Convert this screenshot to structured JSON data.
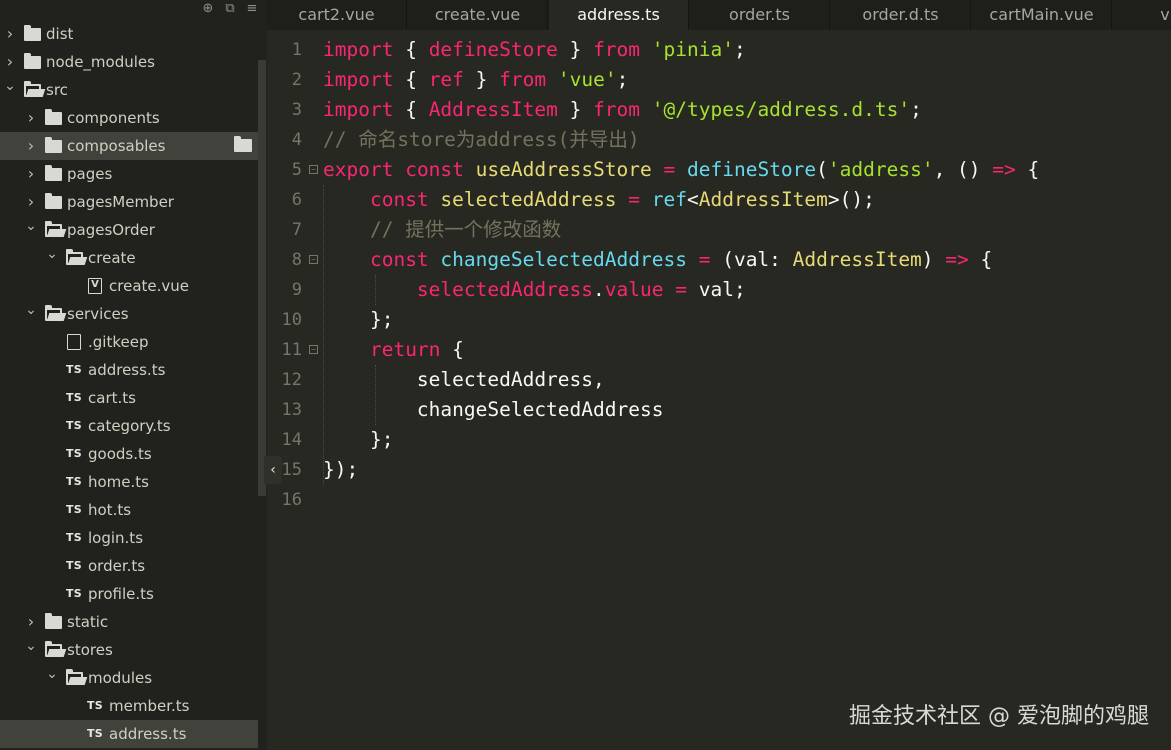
{
  "sidebar": {
    "toolbar": {
      "icons": [
        "locate-icon",
        "collapse-all-icon",
        "menu-icon"
      ]
    },
    "tree": [
      {
        "label": "dist",
        "type": "folder",
        "expanded": false,
        "depth": 0
      },
      {
        "label": "node_modules",
        "type": "folder",
        "expanded": false,
        "depth": 0
      },
      {
        "label": "src",
        "type": "folder",
        "expanded": true,
        "depth": 0
      },
      {
        "label": "components",
        "type": "folder",
        "expanded": false,
        "depth": 1
      },
      {
        "label": "composables",
        "type": "folder",
        "expanded": false,
        "depth": 1,
        "hovered": true
      },
      {
        "label": "pages",
        "type": "folder",
        "expanded": false,
        "depth": 1
      },
      {
        "label": "pagesMember",
        "type": "folder",
        "expanded": false,
        "depth": 1
      },
      {
        "label": "pagesOrder",
        "type": "folder",
        "expanded": true,
        "depth": 1
      },
      {
        "label": "create",
        "type": "folder",
        "expanded": true,
        "depth": 2
      },
      {
        "label": "create.vue",
        "type": "vue",
        "depth": 3
      },
      {
        "label": "services",
        "type": "folder",
        "expanded": true,
        "depth": 1
      },
      {
        "label": ".gitkeep",
        "type": "file",
        "depth": 2
      },
      {
        "label": "address.ts",
        "type": "ts",
        "depth": 2
      },
      {
        "label": "cart.ts",
        "type": "ts",
        "depth": 2
      },
      {
        "label": "category.ts",
        "type": "ts",
        "depth": 2
      },
      {
        "label": "goods.ts",
        "type": "ts",
        "depth": 2
      },
      {
        "label": "home.ts",
        "type": "ts",
        "depth": 2
      },
      {
        "label": "hot.ts",
        "type": "ts",
        "depth": 2
      },
      {
        "label": "login.ts",
        "type": "ts",
        "depth": 2
      },
      {
        "label": "order.ts",
        "type": "ts",
        "depth": 2
      },
      {
        "label": "profile.ts",
        "type": "ts",
        "depth": 2
      },
      {
        "label": "static",
        "type": "folder",
        "expanded": false,
        "depth": 1
      },
      {
        "label": "stores",
        "type": "folder",
        "expanded": true,
        "depth": 1
      },
      {
        "label": "modules",
        "type": "folder",
        "expanded": true,
        "depth": 2
      },
      {
        "label": "member.ts",
        "type": "ts",
        "depth": 3
      },
      {
        "label": "address.ts",
        "type": "ts",
        "depth": 3,
        "selected": true
      }
    ],
    "ts_badge": "TS",
    "vue_badge": "V"
  },
  "tabs": [
    {
      "label": "cart2.vue",
      "active": false
    },
    {
      "label": "create.vue",
      "active": false
    },
    {
      "label": "address.ts",
      "active": true
    },
    {
      "label": "order.ts",
      "active": false
    },
    {
      "label": "order.d.ts",
      "active": false
    },
    {
      "label": "cartMain.vue",
      "active": false
    },
    {
      "label": "vk-da",
      "active": false
    }
  ],
  "editor": {
    "lines": [
      {
        "n": "1",
        "fold": false,
        "tokens": [
          [
            "k",
            "import"
          ],
          [
            "o",
            " { "
          ],
          [
            "v",
            "defineStore"
          ],
          [
            "o",
            " } "
          ],
          [
            "k",
            "from"
          ],
          [
            "o",
            " "
          ],
          [
            "s",
            "'pinia'"
          ],
          [
            "o",
            ";"
          ]
        ]
      },
      {
        "n": "2",
        "fold": false,
        "tokens": [
          [
            "k",
            "import"
          ],
          [
            "o",
            " { "
          ],
          [
            "v",
            "ref"
          ],
          [
            "o",
            " } "
          ],
          [
            "k",
            "from"
          ],
          [
            "o",
            " "
          ],
          [
            "s",
            "'vue'"
          ],
          [
            "o",
            ";"
          ]
        ]
      },
      {
        "n": "3",
        "fold": false,
        "tokens": [
          [
            "k",
            "import"
          ],
          [
            "o",
            " { "
          ],
          [
            "v",
            "AddressItem"
          ],
          [
            "o",
            " } "
          ],
          [
            "k",
            "from"
          ],
          [
            "o",
            " "
          ],
          [
            "s",
            "'@/types/address.d.ts'"
          ],
          [
            "o",
            ";"
          ]
        ]
      },
      {
        "n": "4",
        "fold": false,
        "tokens": [
          [
            "c",
            "// 命名store为address(并导出)"
          ]
        ]
      },
      {
        "n": "5",
        "fold": true,
        "tokens": [
          [
            "k",
            "export"
          ],
          [
            "o",
            " "
          ],
          [
            "k",
            "const"
          ],
          [
            "o",
            " "
          ],
          [
            "t",
            "useAddressStore"
          ],
          [
            "o",
            " "
          ],
          [
            "p",
            "="
          ],
          [
            "o",
            " "
          ],
          [
            "f",
            "defineStore"
          ],
          [
            "o",
            "("
          ],
          [
            "s",
            "'address'"
          ],
          [
            "o",
            ", () "
          ],
          [
            "p",
            "=>"
          ],
          [
            "o",
            " {"
          ]
        ]
      },
      {
        "n": "6",
        "fold": false,
        "tokens": [
          [
            "o",
            "    "
          ],
          [
            "k",
            "const"
          ],
          [
            "o",
            " "
          ],
          [
            "t",
            "selectedAddress"
          ],
          [
            "o",
            " "
          ],
          [
            "p",
            "="
          ],
          [
            "o",
            " "
          ],
          [
            "f",
            "ref"
          ],
          [
            "o",
            "<"
          ],
          [
            "t",
            "AddressItem"
          ],
          [
            "o",
            ">();"
          ]
        ]
      },
      {
        "n": "7",
        "fold": false,
        "tokens": [
          [
            "o",
            "    "
          ],
          [
            "c",
            "// 提供一个修改函数"
          ]
        ]
      },
      {
        "n": "8",
        "fold": true,
        "tokens": [
          [
            "o",
            "    "
          ],
          [
            "k",
            "const"
          ],
          [
            "o",
            " "
          ],
          [
            "f",
            "changeSelectedAddress"
          ],
          [
            "o",
            " "
          ],
          [
            "p",
            "="
          ],
          [
            "o",
            " (val: "
          ],
          [
            "t",
            "AddressItem"
          ],
          [
            "o",
            ") "
          ],
          [
            "p",
            "=>"
          ],
          [
            "o",
            " {"
          ]
        ]
      },
      {
        "n": "9",
        "fold": false,
        "tokens": [
          [
            "o",
            "        "
          ],
          [
            "v",
            "selectedAddress"
          ],
          [
            "o",
            "."
          ],
          [
            "v",
            "value"
          ],
          [
            "o",
            " "
          ],
          [
            "p",
            "="
          ],
          [
            "o",
            " val;"
          ]
        ]
      },
      {
        "n": "10",
        "fold": false,
        "tokens": [
          [
            "o",
            "    };"
          ]
        ]
      },
      {
        "n": "11",
        "fold": true,
        "tokens": [
          [
            "o",
            "    "
          ],
          [
            "k",
            "return"
          ],
          [
            "o",
            " {"
          ]
        ]
      },
      {
        "n": "12",
        "fold": false,
        "tokens": [
          [
            "o",
            "        selectedAddress,"
          ]
        ]
      },
      {
        "n": "13",
        "fold": false,
        "tokens": [
          [
            "o",
            "        changeSelectedAddress"
          ]
        ]
      },
      {
        "n": "14",
        "fold": false,
        "tokens": [
          [
            "o",
            "    };"
          ]
        ]
      },
      {
        "n": "15",
        "fold": false,
        "tokens": [
          [
            "o",
            "});"
          ]
        ]
      },
      {
        "n": "16",
        "fold": false,
        "tokens": []
      }
    ]
  },
  "watermark": "掘金技术社区 @ 爱泡脚的鸡腿",
  "colors": {
    "background": "#272822",
    "sidebar_bg": "#21221d",
    "keyword": "#f92672",
    "string": "#a6e22e",
    "function": "#66d9ef",
    "type": "#e6db74",
    "comment": "#75715e"
  }
}
